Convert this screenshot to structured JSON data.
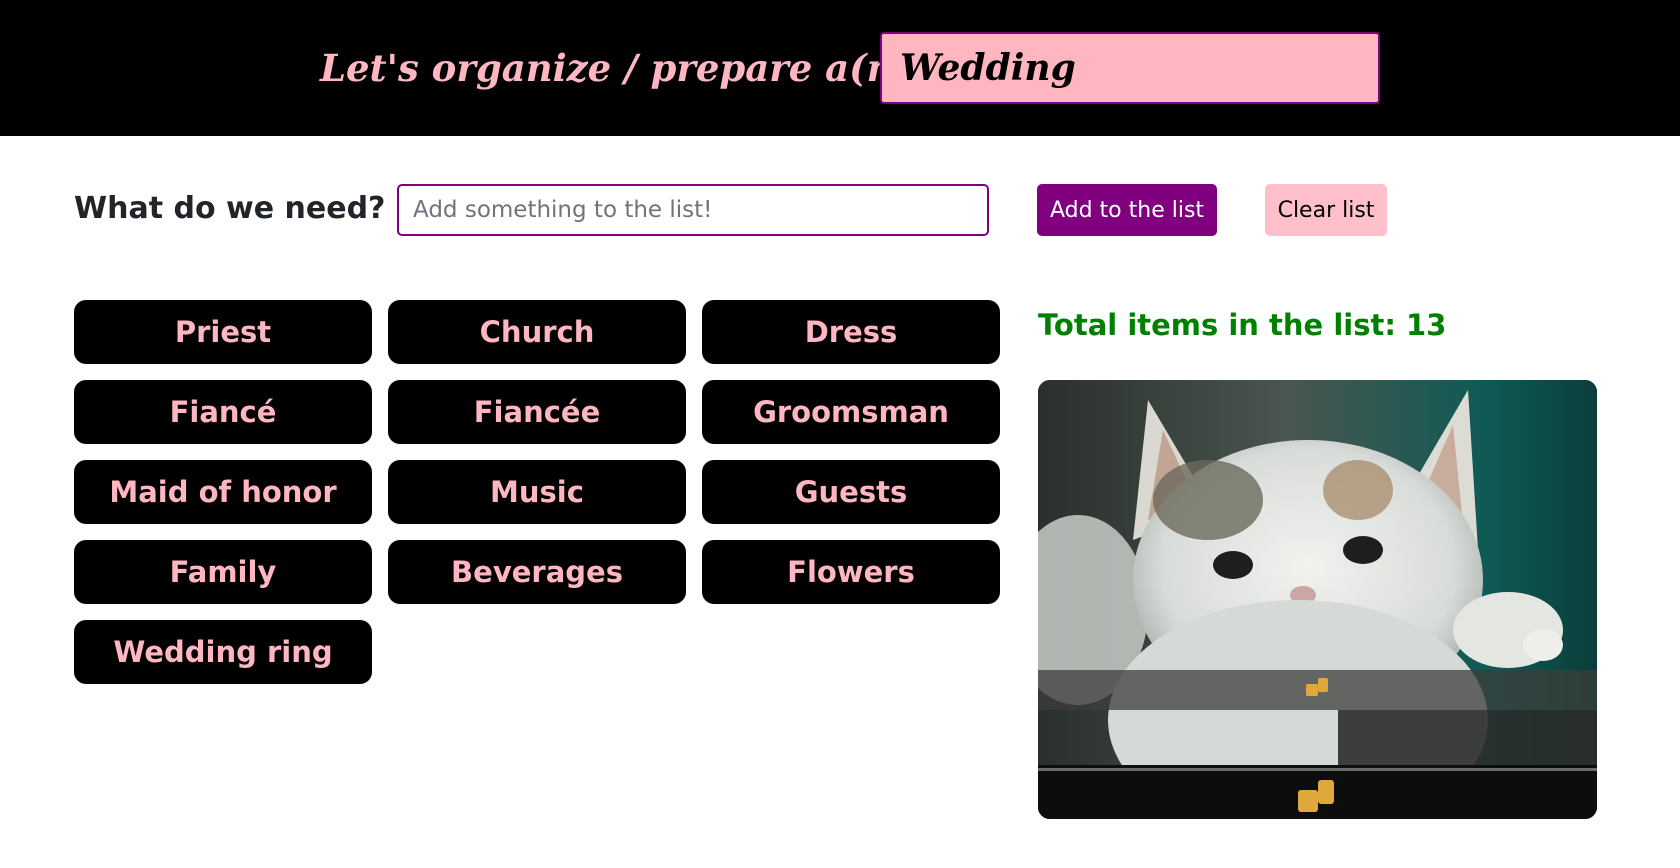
{
  "header": {
    "title": "Let's organize / prepare a(n):",
    "event_value": "Wedding"
  },
  "form": {
    "label": "What do we need?",
    "placeholder": "Add something to the list!",
    "add_label": "Add to the list",
    "clear_label": "Clear list"
  },
  "items": [
    "Priest",
    "Church",
    "Dress",
    "Fiancé",
    "Fiancée",
    "Groomsman",
    "Maid of honor",
    "Music",
    "Guests",
    "Family",
    "Beverages",
    "Flowers",
    "Wedding ring"
  ],
  "summary": {
    "label": "Total items in the list: 13"
  },
  "image": {
    "subject": "kitten thumbs-up"
  },
  "colors": {
    "accent_purple": "#800080",
    "pink": "#ffb6c1",
    "total_green": "#008000",
    "header_bg": "#000000"
  }
}
